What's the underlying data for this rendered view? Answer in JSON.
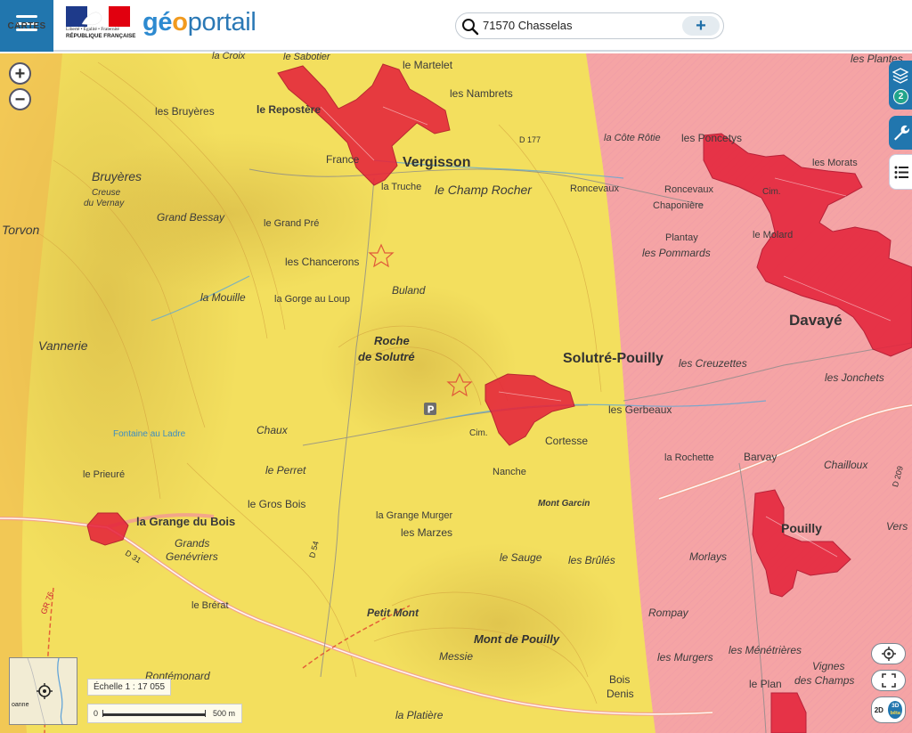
{
  "header": {
    "menu_label": "CARTES",
    "gov_motto": "Liberté • Égalité • Fraternité",
    "gov_name": "RÉPUBLIQUE FRANÇAISE",
    "brand_g": "g",
    "brand_eo": "é",
    "brand_o": "o",
    "brand_rest": "portail"
  },
  "search": {
    "query": "71570 Chasselas",
    "add_symbol": "+"
  },
  "controls": {
    "zoom_in": "+",
    "zoom_out": "−",
    "layers_count": "2",
    "mode_2d": "2D",
    "mode_3d": "3D",
    "mode_beta": "bêta"
  },
  "scale": {
    "label": "Échelle 1 : 17 055",
    "start": "0",
    "end": "500 m"
  },
  "minimap": {
    "town": "oanne"
  },
  "map_labels": {
    "vergisson": "Vergisson",
    "solutre": "Solutré-Pouilly",
    "davaye": "Davayé",
    "pouilly": "Pouilly",
    "grange": "la Grange du Bois",
    "repostere": "le Repostère",
    "roche_1": "Roche",
    "roche_2": "de Solutré",
    "mont_pouilly": "Mont de Pouilly",
    "martelet": "le Martelet",
    "nambrets": "les Nambrets",
    "sabotier": "le Sabotier",
    "croix": "la Croix",
    "bruyeres": "les Bruyères",
    "bruyeres2": "Bruyères",
    "creuse": "Creuse",
    "vernay": "du Vernay",
    "france": "France",
    "truche": "la Truche",
    "champ_rocher": "le Champ Rocher",
    "grand_bessay": "Grand Bessay",
    "grand_pre": "le Grand Pré",
    "torvon": "Torvon",
    "chancerons": "les Chancerons",
    "mouille": "la Mouille",
    "gorge": "la Gorge au Loup",
    "buland": "Buland",
    "vannerie": "Vannerie",
    "chaux": "Chaux",
    "fontaine": "Fontaine au Ladre",
    "perret": "le Perret",
    "prieure": "le Prieuré",
    "gros_bois": "le Gros Bois",
    "grands": "Grands",
    "genevriers": "Genévriers",
    "grange_murger": "la Grange Murger",
    "marzes": "les Marzes",
    "brerat": "le Brérat",
    "petit_mont": "Petit Mont",
    "messie": "Messie",
    "rontemonard": "Rontémonard",
    "platiere": "la Platière",
    "sauge": "le Sauge",
    "brules": "les Brûlés",
    "mont_garcin": "Mont Garcin",
    "nanche": "Nanche",
    "cortesse": "Cortesse",
    "cote_rotie": "la Côte Rôtie",
    "roncevaux": "Roncevaux",
    "roncevaux2": "Roncevaux",
    "chaponiere": "Chaponière",
    "plantay": "Plantay",
    "pommards": "les Pommards",
    "poncetys": "les Poncetys",
    "morats": "les Morats",
    "molard": "le Molard",
    "creuzettes": "les Creuzettes",
    "jonchets": "les Jonchets",
    "gerbeaux": "les Gerbeaux",
    "rochette": "la Rochette",
    "barvay": "Barvay",
    "chailloux": "Chailloux",
    "vers": "Vers",
    "morlays": "Morlays",
    "rompay": "Rompay",
    "murgers": "les Murgers",
    "menetrieres": "les Ménétrières",
    "vignes_1": "Vignes",
    "vignes_2": "des Champs",
    "le_plan": "le Plan",
    "bois_1": "Bois",
    "bois_2": "Denis",
    "plantes": "les Plantes",
    "cim": "Cim.",
    "d31": "D 31",
    "d54": "D 54",
    "d209": "D 209",
    "d177": "D 177",
    "gr": "GR 76"
  }
}
